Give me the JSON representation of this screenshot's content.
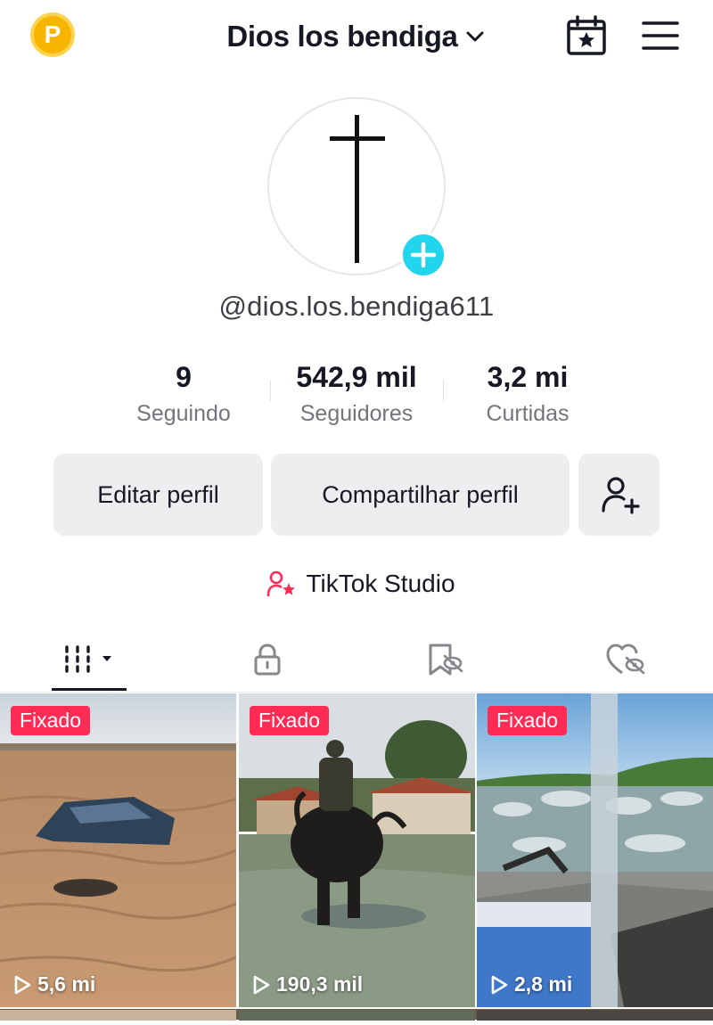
{
  "header": {
    "coin_letter": "P",
    "title": "Dios los bendiga",
    "calendar_icon": "calendar-star-icon",
    "menu_icon": "hamburger-menu-icon"
  },
  "profile": {
    "username": "@dios.los.bendiga611",
    "avatar_icon": "cross-icon",
    "add_icon": "plus-icon"
  },
  "stats": [
    {
      "value": "9",
      "label": "Seguindo"
    },
    {
      "value": "542,9 mil",
      "label": "Seguidores"
    },
    {
      "value": "3,2 mi",
      "label": "Curtidas"
    }
  ],
  "buttons": {
    "edit": "Editar perfil",
    "share": "Compartilhar perfil",
    "add_friend_icon": "add-user-icon"
  },
  "studio": {
    "label": "TikTok Studio",
    "icon": "user-star-icon"
  },
  "tabs": [
    {
      "icon": "grid-icon",
      "active": true
    },
    {
      "icon": "lock-icon",
      "active": false
    },
    {
      "icon": "bookmark-hidden-icon",
      "active": false
    },
    {
      "icon": "heart-hidden-icon",
      "active": false
    }
  ],
  "videos": [
    {
      "badge": "Fixado",
      "views": "5,6 mi"
    },
    {
      "badge": "Fixado",
      "views": "190,3 mil"
    },
    {
      "badge": "Fixado",
      "views": "2,8 mi"
    }
  ],
  "colors": {
    "accent": "#fe2c55",
    "plus": "#20d5ec",
    "coin": "#f7b500",
    "button_bg": "#eeeef0"
  }
}
